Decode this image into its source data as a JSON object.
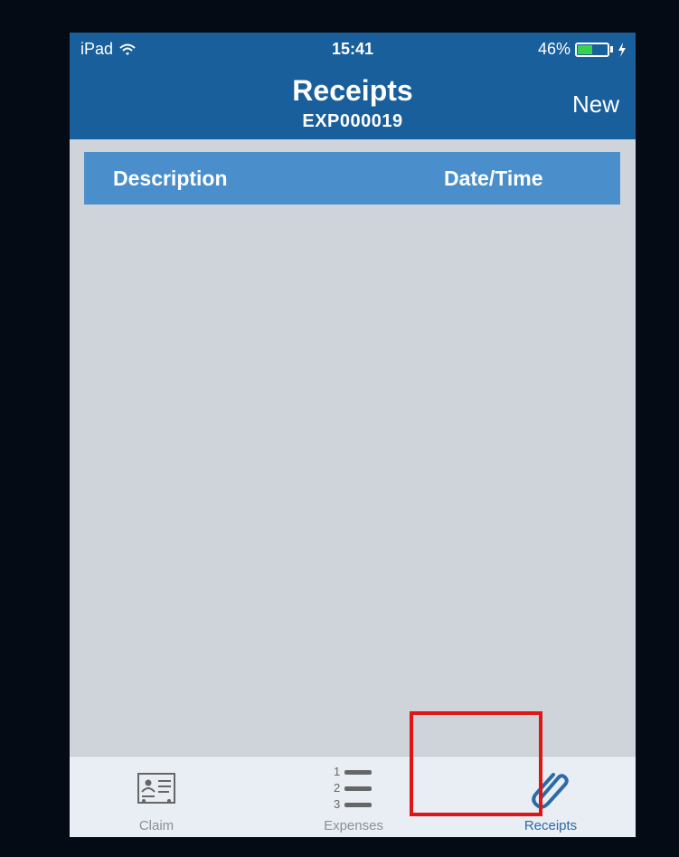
{
  "status_bar": {
    "device": "iPad",
    "time": "15:41",
    "battery_percent": "46%",
    "battery_level": 0.46,
    "icons": [
      "wifi-icon",
      "battery-icon",
      "charging-icon"
    ]
  },
  "nav": {
    "title": "Receipts",
    "subtitle": "EXP000019",
    "new_label": "New"
  },
  "table": {
    "columns": [
      "Description",
      "Date/Time"
    ],
    "rows": []
  },
  "tabbar": {
    "tabs": [
      {
        "label": "Claim",
        "icon": "id-card-icon",
        "active": false
      },
      {
        "label": "Expenses",
        "icon": "numbered-list-icon",
        "active": false
      },
      {
        "label": "Receipts",
        "icon": "paperclip-icon",
        "active": true
      }
    ]
  },
  "colors": {
    "nav_bar": "#195f9c",
    "table_header": "#4a8fcb",
    "content_bg": "#cfd4da",
    "active_tab": "#2c6aa6",
    "highlight": "#e01616"
  }
}
